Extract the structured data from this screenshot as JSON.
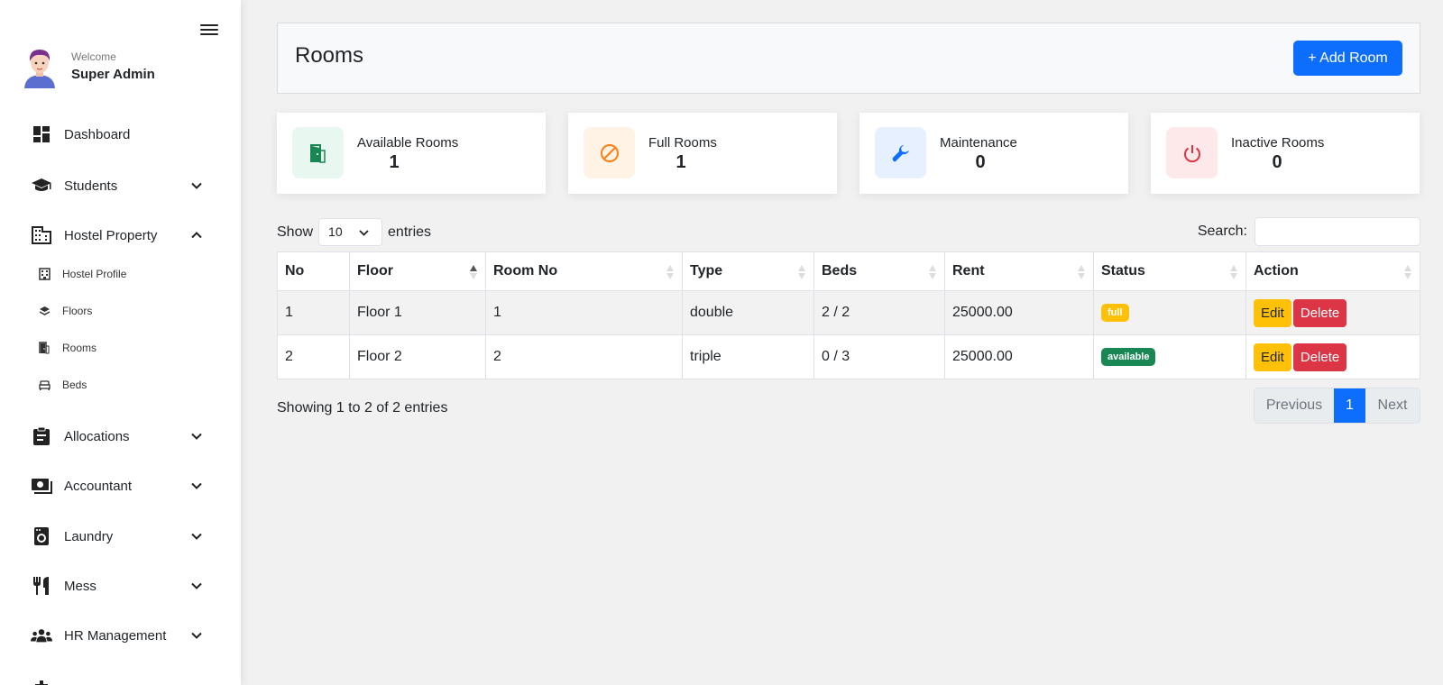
{
  "sidebar": {
    "welcome": "Welcome",
    "user_name": "Super Admin",
    "items": [
      {
        "label": "Dashboard",
        "icon": "dashboard-icon"
      },
      {
        "label": "Students",
        "icon": "graduation-cap-icon"
      },
      {
        "label": "Hostel Property",
        "icon": "building-icon"
      },
      {
        "label": "Allocations",
        "icon": "clipboard-icon"
      },
      {
        "label": "Accountant",
        "icon": "money-icon"
      },
      {
        "label": "Laundry",
        "icon": "washing-machine-icon"
      },
      {
        "label": "Mess",
        "icon": "utensils-icon"
      },
      {
        "label": "HR Management",
        "icon": "users-icon"
      }
    ],
    "subitems": [
      {
        "label": "Hostel Profile",
        "icon": "hotel-icon"
      },
      {
        "label": "Floors",
        "icon": "layers-icon"
      },
      {
        "label": "Rooms",
        "icon": "door-icon"
      },
      {
        "label": "Beds",
        "icon": "bed-icon"
      }
    ]
  },
  "header": {
    "title": "Rooms",
    "add_button": "+ Add Room"
  },
  "stats": [
    {
      "label": "Available Rooms",
      "value": "1",
      "color": "#198754",
      "bg": "#e8f7ef",
      "icon": "door-open-icon"
    },
    {
      "label": "Full Rooms",
      "value": "1",
      "color": "#fd7e14",
      "bg": "#fff3e6",
      "icon": "ban-icon"
    },
    {
      "label": "Maintenance",
      "value": "0",
      "color": "#0d6efd",
      "bg": "#e7f0ff",
      "icon": "wrench-icon"
    },
    {
      "label": "Inactive Rooms",
      "value": "0",
      "color": "#dc3545",
      "bg": "#fde8ea",
      "icon": "power-icon"
    }
  ],
  "table_controls": {
    "show": "Show",
    "entries_value": "10",
    "entries": "entries",
    "search_label": "Search:"
  },
  "table": {
    "columns": [
      "No",
      "Floor",
      "Room No",
      "Type",
      "Beds",
      "Rent",
      "Status",
      "Action"
    ],
    "rows": [
      {
        "no": "1",
        "floor": "Floor 1",
        "room_no": "1",
        "type": "double",
        "beds": "2 / 2",
        "rent": "25000.00",
        "status": "full",
        "status_color": "#ffc107"
      },
      {
        "no": "2",
        "floor": "Floor 2",
        "room_no": "2",
        "type": "triple",
        "beds": "0 / 3",
        "rent": "25000.00",
        "status": "available",
        "status_color": "#198754"
      }
    ],
    "edit_label": "Edit",
    "delete_label": "Delete"
  },
  "footer": {
    "showing": "Showing 1 to 2 of 2 entries",
    "previous": "Previous",
    "page": "1",
    "next": "Next"
  }
}
